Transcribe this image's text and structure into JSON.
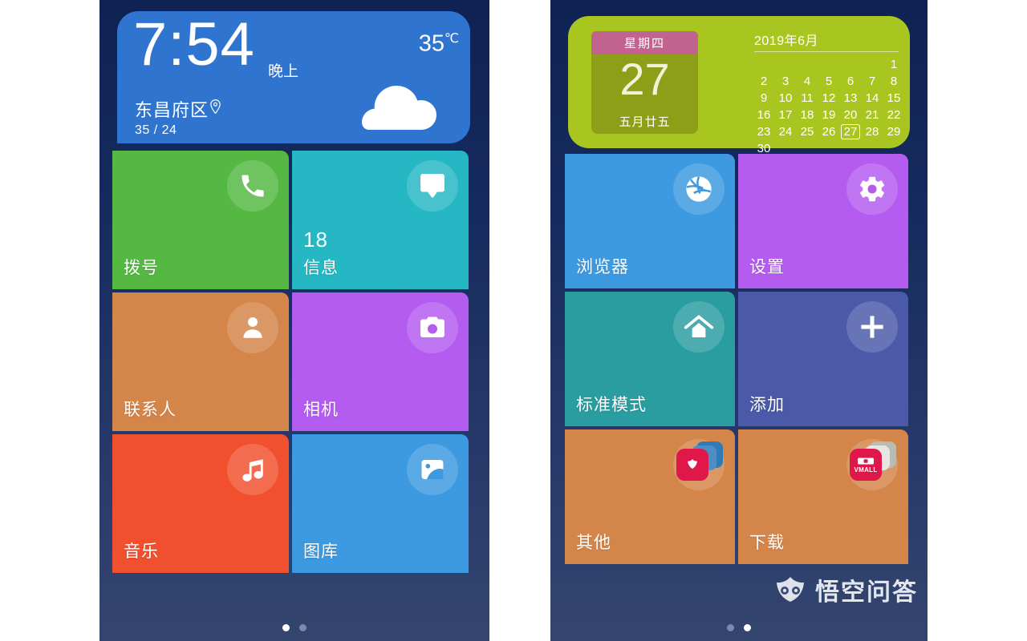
{
  "theme": {
    "bg_top": "#0f2254",
    "bg_bottom": "#34456f",
    "tile_text": "#ffffff"
  },
  "left_phone": {
    "weather": {
      "time": "7:54",
      "ampm": "晚上",
      "temperature": "35",
      "temperature_unit": "℃",
      "city": "东昌府区",
      "range": "35 / 24",
      "location_icon": "location-pin-icon",
      "condition_icon": "cloud-icon",
      "bg_color": "#2f74cf"
    },
    "tiles": [
      {
        "label": "拨号",
        "icon": "phone-icon",
        "color": "#55b843",
        "count": ""
      },
      {
        "label": "信息",
        "icon": "message-icon",
        "color": "#25b7c3",
        "count": "18"
      },
      {
        "label": "联系人",
        "icon": "person-icon",
        "color": "#d4854a",
        "count": ""
      },
      {
        "label": "相机",
        "icon": "camera-icon",
        "color": "#b45cf0",
        "count": ""
      },
      {
        "label": "音乐",
        "icon": "music-icon",
        "color": "#f1502f",
        "count": ""
      },
      {
        "label": "图库",
        "icon": "gallery-icon",
        "color": "#3d9ae0",
        "count": ""
      }
    ],
    "page_dots": {
      "count": 2,
      "active": 0
    }
  },
  "right_phone": {
    "calendar": {
      "weekday": "星期四",
      "day": "27",
      "lunar": "五月廿五",
      "month_title": "2019年6月",
      "today": 27,
      "lead_blanks": 6,
      "days": [
        1,
        2,
        3,
        4,
        5,
        6,
        7,
        8,
        9,
        10,
        11,
        12,
        13,
        14,
        15,
        16,
        17,
        18,
        19,
        20,
        21,
        22,
        23,
        24,
        25,
        26,
        27,
        28,
        29,
        30
      ],
      "bg_color": "#a9c520",
      "weekday_color": "#c2628e",
      "daybox_color": "#8d9f18"
    },
    "tiles": [
      {
        "label": "浏览器",
        "icon": "browser-globe-icon",
        "color": "#3d9ae0",
        "count": ""
      },
      {
        "label": "设置",
        "icon": "gear-icon",
        "color": "#b45cf0",
        "count": ""
      },
      {
        "label": "标准模式",
        "icon": "home-icon",
        "color": "#2a9da0",
        "count": ""
      },
      {
        "label": "添加",
        "icon": "plus-icon",
        "color": "#4a5aa8",
        "count": ""
      },
      {
        "label": "其他",
        "icon": "folder-other-icon",
        "color": "#d4854a",
        "count": ""
      },
      {
        "label": "下载",
        "icon": "folder-vmall-icon",
        "color": "#d4854a",
        "count": ""
      }
    ],
    "page_dots": {
      "count": 2,
      "active": 1
    },
    "watermark": {
      "text": "悟空问答",
      "logo_icon": "wukong-logo-icon"
    }
  }
}
